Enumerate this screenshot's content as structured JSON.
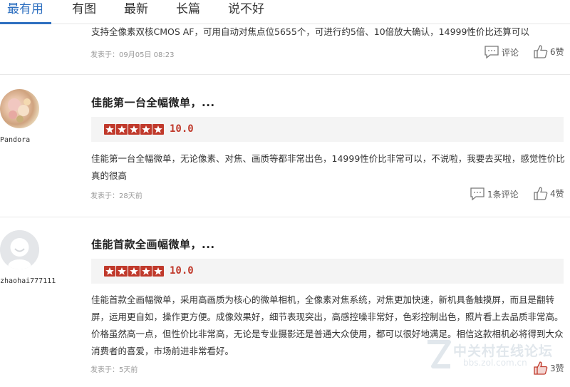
{
  "tabs": [
    {
      "label": "最有用",
      "active": true
    },
    {
      "label": "有图",
      "active": false
    },
    {
      "label": "最新",
      "active": false
    },
    {
      "label": "长篇",
      "active": false
    },
    {
      "label": "说不好",
      "active": false
    }
  ],
  "reviews": [
    {
      "body": "支持全像素双核CMOS AF，可用自动对焦点位5655个，可进行约5倍、10倍放大确认，14999性价比还算可以",
      "posted": "发表于：09月05日 08:23",
      "comment_label": "评论",
      "like_label": "6赞"
    },
    {
      "username": "Pandora",
      "title": "佳能第一台全幅微单，...",
      "rating": 5,
      "score": "10.0",
      "body": "佳能第一台全幅微单，无论像素、对焦、画质等都非常出色，14999性价比非常可以，不说啦，我要去买啦，感觉性价比真的很高",
      "posted": "发表于：28天前",
      "comment_label": "1条评论",
      "like_label": "4赞"
    },
    {
      "username": "zhaohai777111",
      "title": "佳能首款全画幅微单，...",
      "rating": 5,
      "score": "10.0",
      "body": "佳能首款全画幅微单，采用高画质为核心的微单相机，全像素对焦系统，对焦更加快速，新机具备触摸屏，而且是翻转屏，运用更自如，操作更方便。成像效果好，细节表现突出，高感控噪非常好，色彩控制出色，照片看上去品质非常高。价格虽然高一点，但性价比非常高，无论是专业摄影还是普通大众使用，都可以很好地满足。相信这款相机必将得到大众消费者的喜爱，市场前进非常看好。",
      "posted": "发表于：5天前",
      "like_label": "3赞"
    }
  ],
  "watermark": {
    "text": "中关村在线论坛",
    "sub": "bbs.zol.com.cn"
  },
  "colors": {
    "accent": "#2d6fc0",
    "star": "#c0392b",
    "meta": "#999999"
  }
}
